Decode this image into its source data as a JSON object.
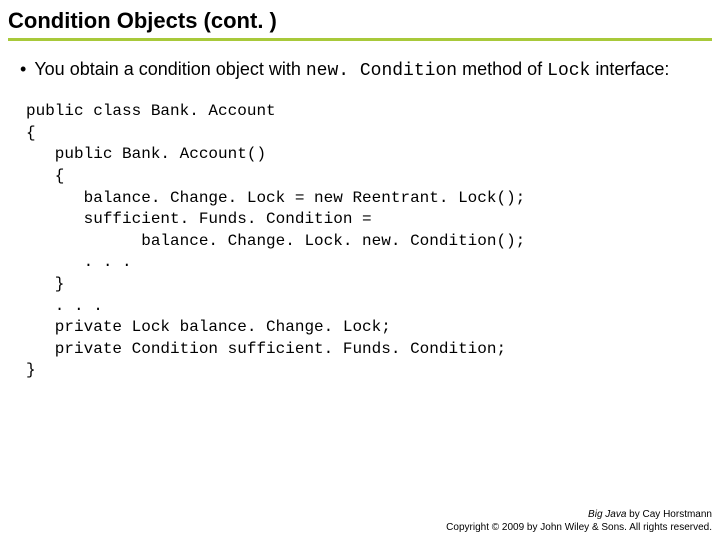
{
  "title": "Condition Objects (cont. )",
  "bullet": {
    "lead": "You obtain a condition object with ",
    "code1": "new. Condition",
    "mid": " method of ",
    "code2": "Lock",
    "tail": " interface:"
  },
  "code": "public class Bank. Account\n{\n   public Bank. Account()\n   {\n      balance. Change. Lock = new Reentrant. Lock();\n      sufficient. Funds. Condition =\n            balance. Change. Lock. new. Condition();\n      . . .\n   }\n   . . .\n   private Lock balance. Change. Lock;\n   private Condition sufficient. Funds. Condition;\n}",
  "footer": {
    "line1_book": "Big Java",
    "line1_rest": " by Cay Horstmann",
    "line2": "Copyright © 2009 by John Wiley & Sons. All rights reserved."
  }
}
